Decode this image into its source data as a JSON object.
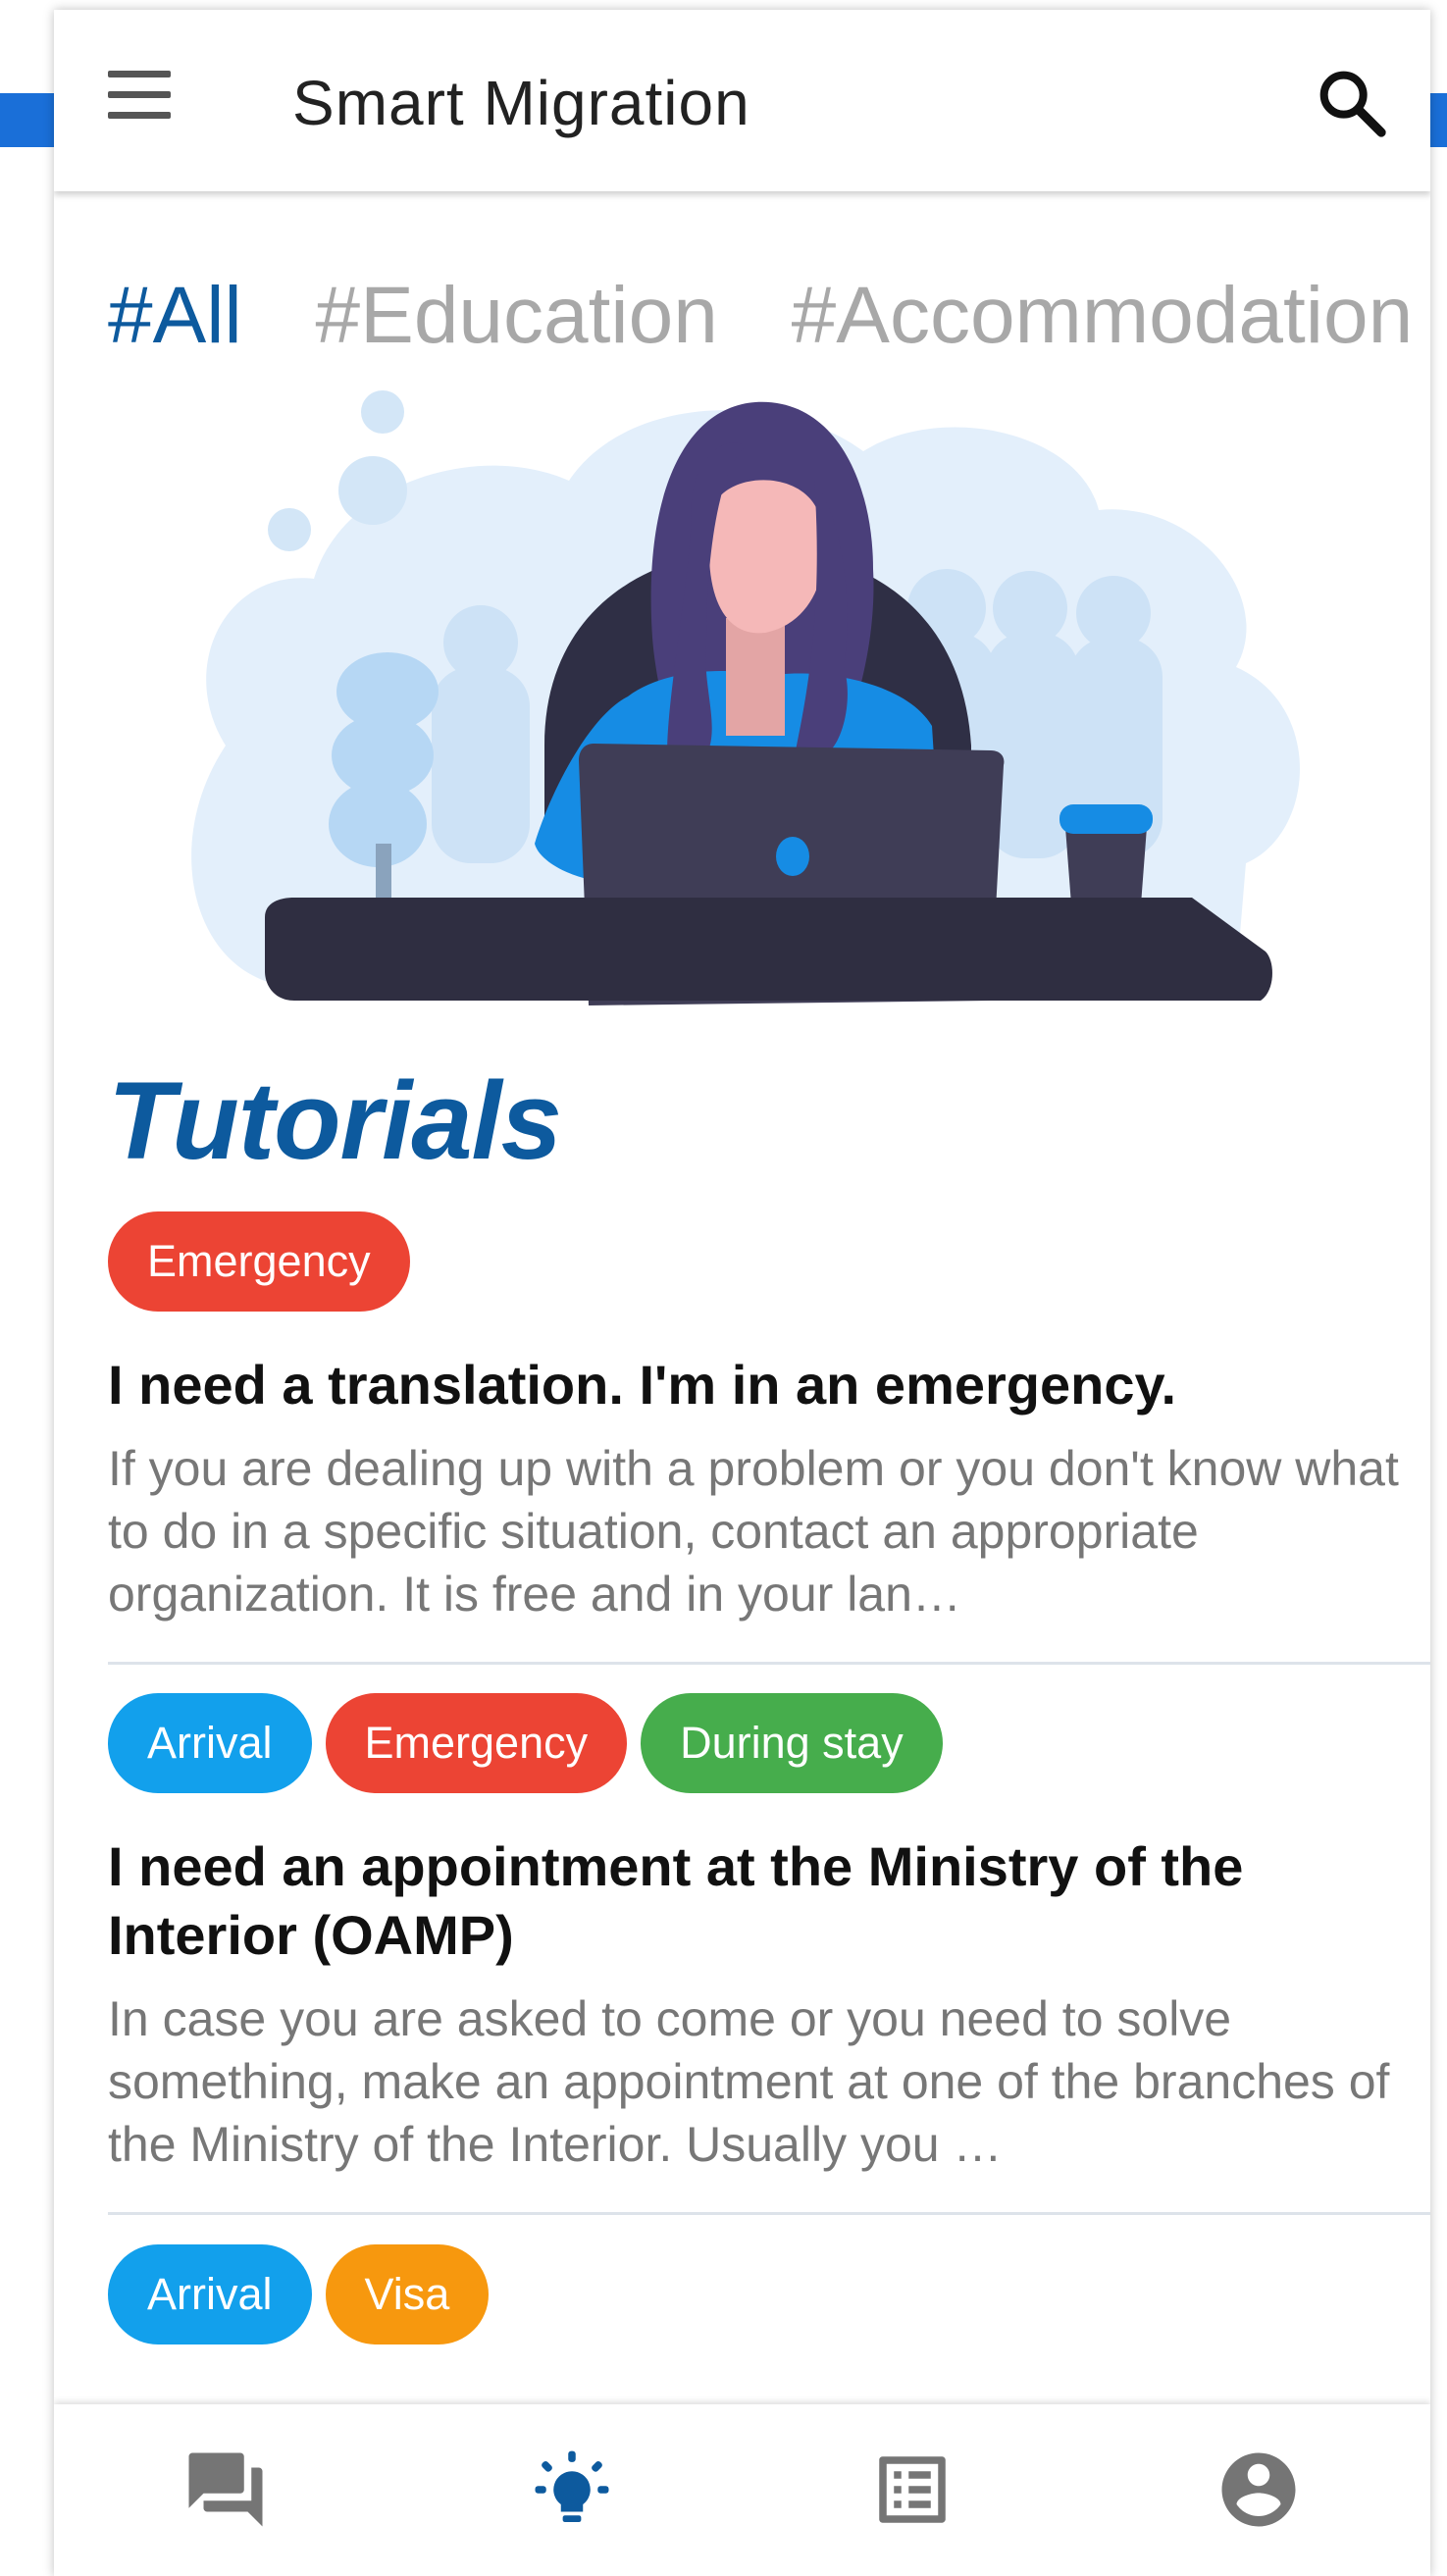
{
  "appbar": {
    "title": "Smart Migration",
    "menu_icon": "menu-icon",
    "search_icon": "search-icon"
  },
  "tags": [
    {
      "label": "#All",
      "active": true
    },
    {
      "label": "#Education",
      "active": false
    },
    {
      "label": "#Accommodation",
      "active": false
    }
  ],
  "section": {
    "title": "Tutorials"
  },
  "tutorials": [
    {
      "chips": [
        {
          "label": "Emergency",
          "color": "#ec4434"
        }
      ],
      "title": "I need a translation. I'm in an emergency.",
      "description": "If you are dealing up with a problem or you don't know what to do in a specific situation, contact an appropriate organization. It is free and in your lan…"
    },
    {
      "chips": [
        {
          "label": "Arrival",
          "color": "#12a0ec"
        },
        {
          "label": "Emergency",
          "color": "#ec4434"
        },
        {
          "label": "During stay",
          "color": "#46ad4c"
        }
      ],
      "title": "I need an appointment at the Ministry of the Interior (OAMP)",
      "description": "In case you are asked to come or you need to solve something, make an appointment at one of the branches of the Ministry of the Interior. Usually you …"
    },
    {
      "chips": [
        {
          "label": "Arrival",
          "color": "#12a0ec"
        },
        {
          "label": "Visa",
          "color": "#f7980e"
        }
      ]
    }
  ],
  "bottom_nav": {
    "items": [
      {
        "icon": "chat-icon",
        "active": false
      },
      {
        "icon": "lightbulb-icon",
        "active": true
      },
      {
        "icon": "list-icon",
        "active": false
      },
      {
        "icon": "account-icon",
        "active": false
      }
    ],
    "active_color": "#0d5a9e",
    "inactive_color": "#757575"
  }
}
